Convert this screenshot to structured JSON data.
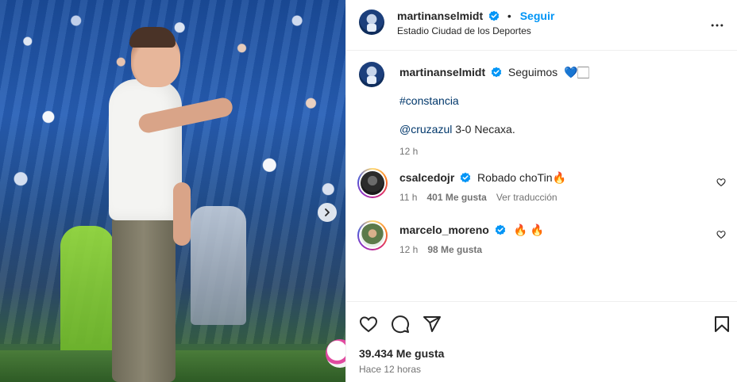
{
  "post": {
    "author": "martinanselmidt",
    "follow_label": "Seguir",
    "location": "Estadio Ciudad de los Deportes",
    "caption": {
      "text": "Seguimos",
      "emojis": "💙🏻",
      "hashtag": "#constancia",
      "mention": "@cruzazul",
      "result": "3-0 Necaxa.",
      "time": "12 h"
    }
  },
  "comments": [
    {
      "username": "csalcedojr",
      "text": "Robado choTin🔥",
      "time": "11 h",
      "likes": "401 Me gusta",
      "translate": "Ver traducción"
    },
    {
      "username": "marcelo_moreno",
      "text": "🔥 🔥",
      "time": "12 h",
      "likes": "98 Me gusta"
    }
  ],
  "footer": {
    "likes": "39.434 Me gusta",
    "time_ago": "Hace 12 horas"
  },
  "colors": {
    "accent": "#0095f6",
    "verified": "#0095f6",
    "link": "#00376b",
    "muted": "#737373"
  },
  "icons": {
    "verified": "verified-badge-icon",
    "more": "more-options-icon",
    "heart": "heart-icon",
    "comment": "comment-icon",
    "share": "share-icon",
    "save": "bookmark-icon",
    "next": "chevron-right-icon"
  }
}
